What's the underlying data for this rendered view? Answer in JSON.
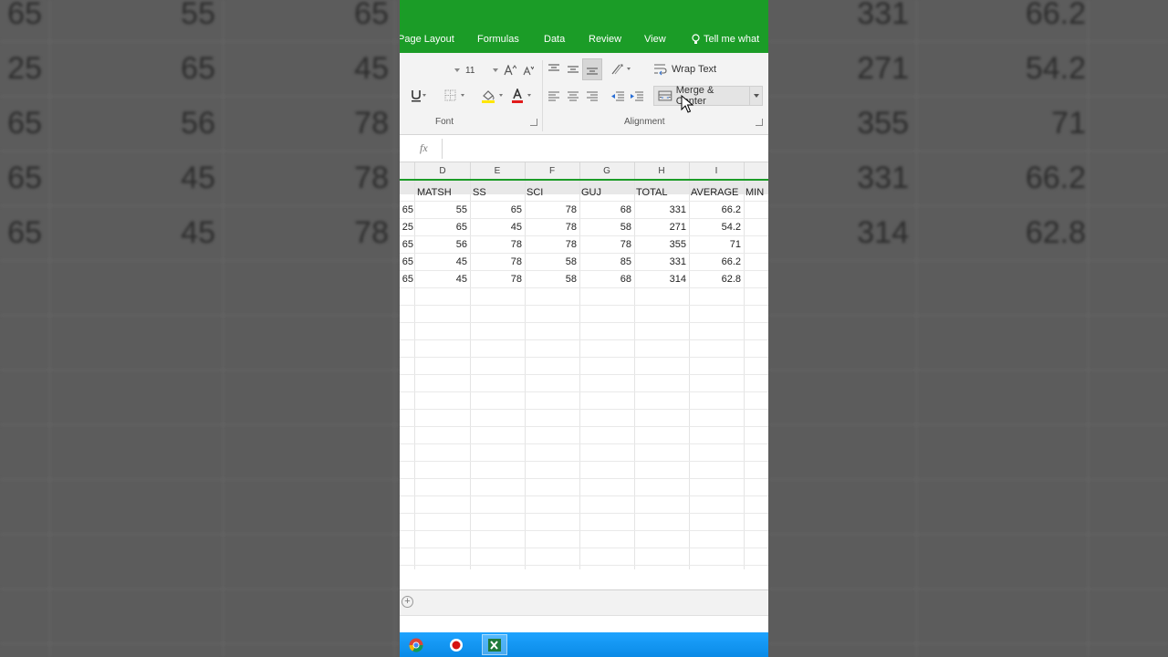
{
  "ribbon_tabs": {
    "page_layout": "Page Layout",
    "formulas": "Formulas",
    "data": "Data",
    "review": "Review",
    "view": "View",
    "tell_me": "Tell me what"
  },
  "ribbon": {
    "font_size": "11",
    "font_group_label": "Font",
    "alignment_group_label": "Alignment",
    "wrap_text_label": "Wrap Text",
    "merge_center_label": "Merge & Center"
  },
  "columns": [
    "D",
    "E",
    "F",
    "G",
    "H",
    "I"
  ],
  "headers": {
    "matsh": "MATSH",
    "ss": "SS",
    "sci": "SCI",
    "guj": "GUJ",
    "total": "TOTAL",
    "average": "AVERAGE",
    "min": "MIN"
  },
  "rows": [
    {
      "c": "65",
      "d": "55",
      "e": "65",
      "f": "78",
      "g": "68",
      "h": "331",
      "i": "66.2"
    },
    {
      "c": "25",
      "d": "65",
      "e": "45",
      "f": "78",
      "g": "58",
      "h": "271",
      "i": "54.2"
    },
    {
      "c": "65",
      "d": "56",
      "e": "78",
      "f": "78",
      "g": "78",
      "h": "355",
      "i": "71"
    },
    {
      "c": "65",
      "d": "45",
      "e": "78",
      "f": "58",
      "g": "85",
      "h": "331",
      "i": "66.2"
    },
    {
      "c": "65",
      "d": "45",
      "e": "78",
      "f": "58",
      "g": "68",
      "h": "314",
      "i": "62.8"
    }
  ],
  "background_left": [
    [
      "65",
      "55",
      "65"
    ],
    [
      "25",
      "65",
      "45"
    ],
    [
      "65",
      "56",
      "78"
    ],
    [
      "65",
      "45",
      "78"
    ],
    [
      "65",
      "45",
      "78"
    ]
  ],
  "background_right": [
    [
      "331",
      "66.2"
    ],
    [
      "271",
      "54.2"
    ],
    [
      "355",
      "71"
    ],
    [
      "331",
      "66.2"
    ],
    [
      "314",
      "62.8"
    ]
  ],
  "colors": {
    "ribbon_green": "#1b9c27",
    "taskbar_blue": "#0a8ae6"
  },
  "taskbar_icons": [
    "chrome-icon",
    "record-icon",
    "excel-icon"
  ]
}
